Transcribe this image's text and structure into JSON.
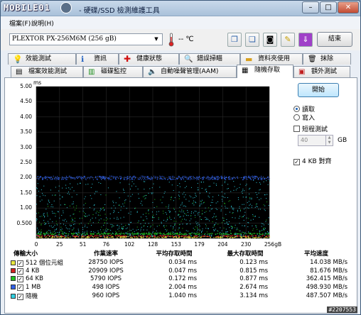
{
  "window": {
    "logo": "MOBILE01",
    "title": "- 硬碟/SSD 檢測維護工具",
    "minimize": "–",
    "maximize": "□",
    "close": "✕"
  },
  "menu": {
    "file": "檔案(F)",
    "help": "說明(H)"
  },
  "toolbar": {
    "drive": "PLEXTOR PX-256M6M (256 gB)",
    "temperature": "-- ℃",
    "exit": "結束"
  },
  "tabs_row1": [
    "效能測試",
    "資訊",
    "健康狀態",
    "錯誤掃瞄",
    "資料夾使用",
    "抹除"
  ],
  "tabs_row2": [
    "檔案效能測試",
    "磁碟監控",
    "自動噪聲管理(AAM)",
    "隨機存取",
    "額外測試"
  ],
  "active_tab": "隨機存取",
  "controls": {
    "start": "開始",
    "read": "讀取",
    "write": "寫入",
    "short_test": "短程測試",
    "size_value": "40",
    "size_unit": "GB",
    "align_4k": "4 KB 對齊"
  },
  "chart_data": {
    "type": "scatter",
    "ylabel": "ms",
    "yticks": [
      "5.00",
      "4.50",
      "4.00",
      "3.50",
      "3.00",
      "2.50",
      "2.00",
      "1.50",
      "1.00",
      "0.500"
    ],
    "xticks": [
      "0",
      "25",
      "51",
      "76",
      "102",
      "128",
      "153",
      "179",
      "204",
      "230",
      "256gB"
    ],
    "ylim": [
      0,
      5.0
    ],
    "xlim": [
      0,
      256
    ],
    "background": "#000000",
    "series": [
      {
        "name": "512 個位元組",
        "color": "#e8e840",
        "band_ms": 0.034
      },
      {
        "name": "4 KB",
        "color": "#d42020",
        "band_ms": 0.047
      },
      {
        "name": "64 KB",
        "color": "#20c020",
        "band_ms": 0.172
      },
      {
        "name": "1 MB",
        "color": "#3060e8",
        "band_ms": 2.004
      },
      {
        "name": "隨機",
        "color": "#30d0e0",
        "band_ms": 1.04
      }
    ]
  },
  "results": {
    "headers": [
      "傳輸大小",
      "作業速率",
      "平均存取時間",
      "最大存取時間",
      "平均速度"
    ],
    "rows": [
      {
        "size": "512 個位元組",
        "rate": "28750 IOPS",
        "avg": "0.034 ms",
        "max": "0.123 ms",
        "speed": "14.038 MB/s",
        "color": "#e8e840"
      },
      {
        "size": "4 KB",
        "rate": "20909 IOPS",
        "avg": "0.047 ms",
        "max": "0.815 ms",
        "speed": "81.676 MB/s",
        "color": "#d42020"
      },
      {
        "size": "64 KB",
        "rate": "5790 IOPS",
        "avg": "0.172 ms",
        "max": "0.877 ms",
        "speed": "362.415 MB/s",
        "color": "#20c020"
      },
      {
        "size": "1 MB",
        "rate": "498 IOPS",
        "avg": "2.004 ms",
        "max": "2.674 ms",
        "speed": "498.930 MB/s",
        "color": "#3060e8"
      },
      {
        "size": "隨機",
        "rate": "960 IOPS",
        "avg": "1.040 ms",
        "max": "3.134 ms",
        "speed": "487.507 MB/s",
        "color": "#30d0e0"
      }
    ]
  },
  "watermark": "#2207553"
}
